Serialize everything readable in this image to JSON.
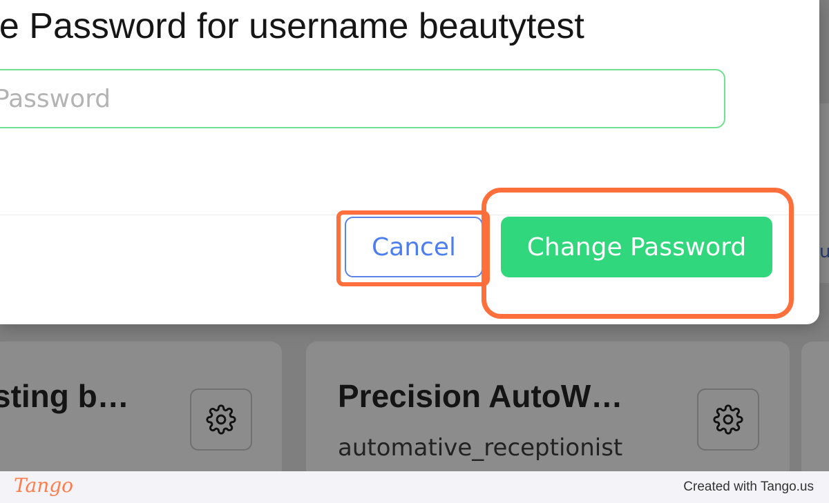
{
  "modal": {
    "title": "ge Password for username beautytest",
    "password_placeholder": "Password",
    "cancel_label": "Cancel",
    "change_label": "Change Password"
  },
  "cards": [
    {
      "title": "sting b…",
      "icon": "gear-icon"
    },
    {
      "title": "Precision AutoW…",
      "subtitle": "automative_receptionist",
      "icon": "gear-icon"
    }
  ],
  "background": {
    "edge_text": "u"
  },
  "footer": {
    "logo": "Tango",
    "credit": "Created with Tango.us"
  },
  "colors": {
    "primary_green": "#31d77c",
    "cancel_blue": "#4d7ef0",
    "highlight_orange": "#ff6f3c",
    "input_border": "#6ee08f"
  }
}
